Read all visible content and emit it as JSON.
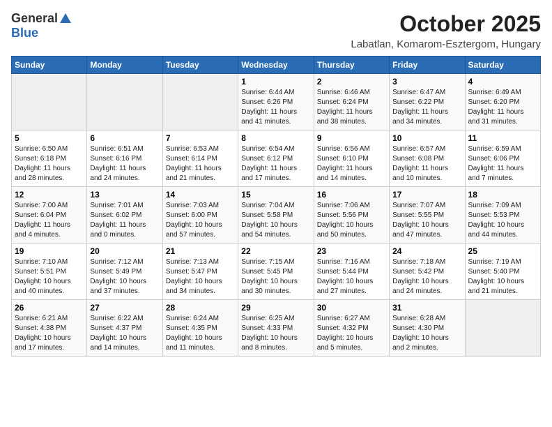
{
  "header": {
    "logo_general": "General",
    "logo_blue": "Blue",
    "month": "October 2025",
    "location": "Labatlan, Komarom-Esztergom, Hungary"
  },
  "days_of_week": [
    "Sunday",
    "Monday",
    "Tuesday",
    "Wednesday",
    "Thursday",
    "Friday",
    "Saturday"
  ],
  "weeks": [
    [
      {
        "day": "",
        "info": ""
      },
      {
        "day": "",
        "info": ""
      },
      {
        "day": "",
        "info": ""
      },
      {
        "day": "1",
        "info": "Sunrise: 6:44 AM\nSunset: 6:26 PM\nDaylight: 11 hours\nand 41 minutes."
      },
      {
        "day": "2",
        "info": "Sunrise: 6:46 AM\nSunset: 6:24 PM\nDaylight: 11 hours\nand 38 minutes."
      },
      {
        "day": "3",
        "info": "Sunrise: 6:47 AM\nSunset: 6:22 PM\nDaylight: 11 hours\nand 34 minutes."
      },
      {
        "day": "4",
        "info": "Sunrise: 6:49 AM\nSunset: 6:20 PM\nDaylight: 11 hours\nand 31 minutes."
      }
    ],
    [
      {
        "day": "5",
        "info": "Sunrise: 6:50 AM\nSunset: 6:18 PM\nDaylight: 11 hours\nand 28 minutes."
      },
      {
        "day": "6",
        "info": "Sunrise: 6:51 AM\nSunset: 6:16 PM\nDaylight: 11 hours\nand 24 minutes."
      },
      {
        "day": "7",
        "info": "Sunrise: 6:53 AM\nSunset: 6:14 PM\nDaylight: 11 hours\nand 21 minutes."
      },
      {
        "day": "8",
        "info": "Sunrise: 6:54 AM\nSunset: 6:12 PM\nDaylight: 11 hours\nand 17 minutes."
      },
      {
        "day": "9",
        "info": "Sunrise: 6:56 AM\nSunset: 6:10 PM\nDaylight: 11 hours\nand 14 minutes."
      },
      {
        "day": "10",
        "info": "Sunrise: 6:57 AM\nSunset: 6:08 PM\nDaylight: 11 hours\nand 10 minutes."
      },
      {
        "day": "11",
        "info": "Sunrise: 6:59 AM\nSunset: 6:06 PM\nDaylight: 11 hours\nand 7 minutes."
      }
    ],
    [
      {
        "day": "12",
        "info": "Sunrise: 7:00 AM\nSunset: 6:04 PM\nDaylight: 11 hours\nand 4 minutes."
      },
      {
        "day": "13",
        "info": "Sunrise: 7:01 AM\nSunset: 6:02 PM\nDaylight: 11 hours\nand 0 minutes."
      },
      {
        "day": "14",
        "info": "Sunrise: 7:03 AM\nSunset: 6:00 PM\nDaylight: 10 hours\nand 57 minutes."
      },
      {
        "day": "15",
        "info": "Sunrise: 7:04 AM\nSunset: 5:58 PM\nDaylight: 10 hours\nand 54 minutes."
      },
      {
        "day": "16",
        "info": "Sunrise: 7:06 AM\nSunset: 5:56 PM\nDaylight: 10 hours\nand 50 minutes."
      },
      {
        "day": "17",
        "info": "Sunrise: 7:07 AM\nSunset: 5:55 PM\nDaylight: 10 hours\nand 47 minutes."
      },
      {
        "day": "18",
        "info": "Sunrise: 7:09 AM\nSunset: 5:53 PM\nDaylight: 10 hours\nand 44 minutes."
      }
    ],
    [
      {
        "day": "19",
        "info": "Sunrise: 7:10 AM\nSunset: 5:51 PM\nDaylight: 10 hours\nand 40 minutes."
      },
      {
        "day": "20",
        "info": "Sunrise: 7:12 AM\nSunset: 5:49 PM\nDaylight: 10 hours\nand 37 minutes."
      },
      {
        "day": "21",
        "info": "Sunrise: 7:13 AM\nSunset: 5:47 PM\nDaylight: 10 hours\nand 34 minutes."
      },
      {
        "day": "22",
        "info": "Sunrise: 7:15 AM\nSunset: 5:45 PM\nDaylight: 10 hours\nand 30 minutes."
      },
      {
        "day": "23",
        "info": "Sunrise: 7:16 AM\nSunset: 5:44 PM\nDaylight: 10 hours\nand 27 minutes."
      },
      {
        "day": "24",
        "info": "Sunrise: 7:18 AM\nSunset: 5:42 PM\nDaylight: 10 hours\nand 24 minutes."
      },
      {
        "day": "25",
        "info": "Sunrise: 7:19 AM\nSunset: 5:40 PM\nDaylight: 10 hours\nand 21 minutes."
      }
    ],
    [
      {
        "day": "26",
        "info": "Sunrise: 6:21 AM\nSunset: 4:38 PM\nDaylight: 10 hours\nand 17 minutes."
      },
      {
        "day": "27",
        "info": "Sunrise: 6:22 AM\nSunset: 4:37 PM\nDaylight: 10 hours\nand 14 minutes."
      },
      {
        "day": "28",
        "info": "Sunrise: 6:24 AM\nSunset: 4:35 PM\nDaylight: 10 hours\nand 11 minutes."
      },
      {
        "day": "29",
        "info": "Sunrise: 6:25 AM\nSunset: 4:33 PM\nDaylight: 10 hours\nand 8 minutes."
      },
      {
        "day": "30",
        "info": "Sunrise: 6:27 AM\nSunset: 4:32 PM\nDaylight: 10 hours\nand 5 minutes."
      },
      {
        "day": "31",
        "info": "Sunrise: 6:28 AM\nSunset: 4:30 PM\nDaylight: 10 hours\nand 2 minutes."
      },
      {
        "day": "",
        "info": ""
      }
    ]
  ]
}
